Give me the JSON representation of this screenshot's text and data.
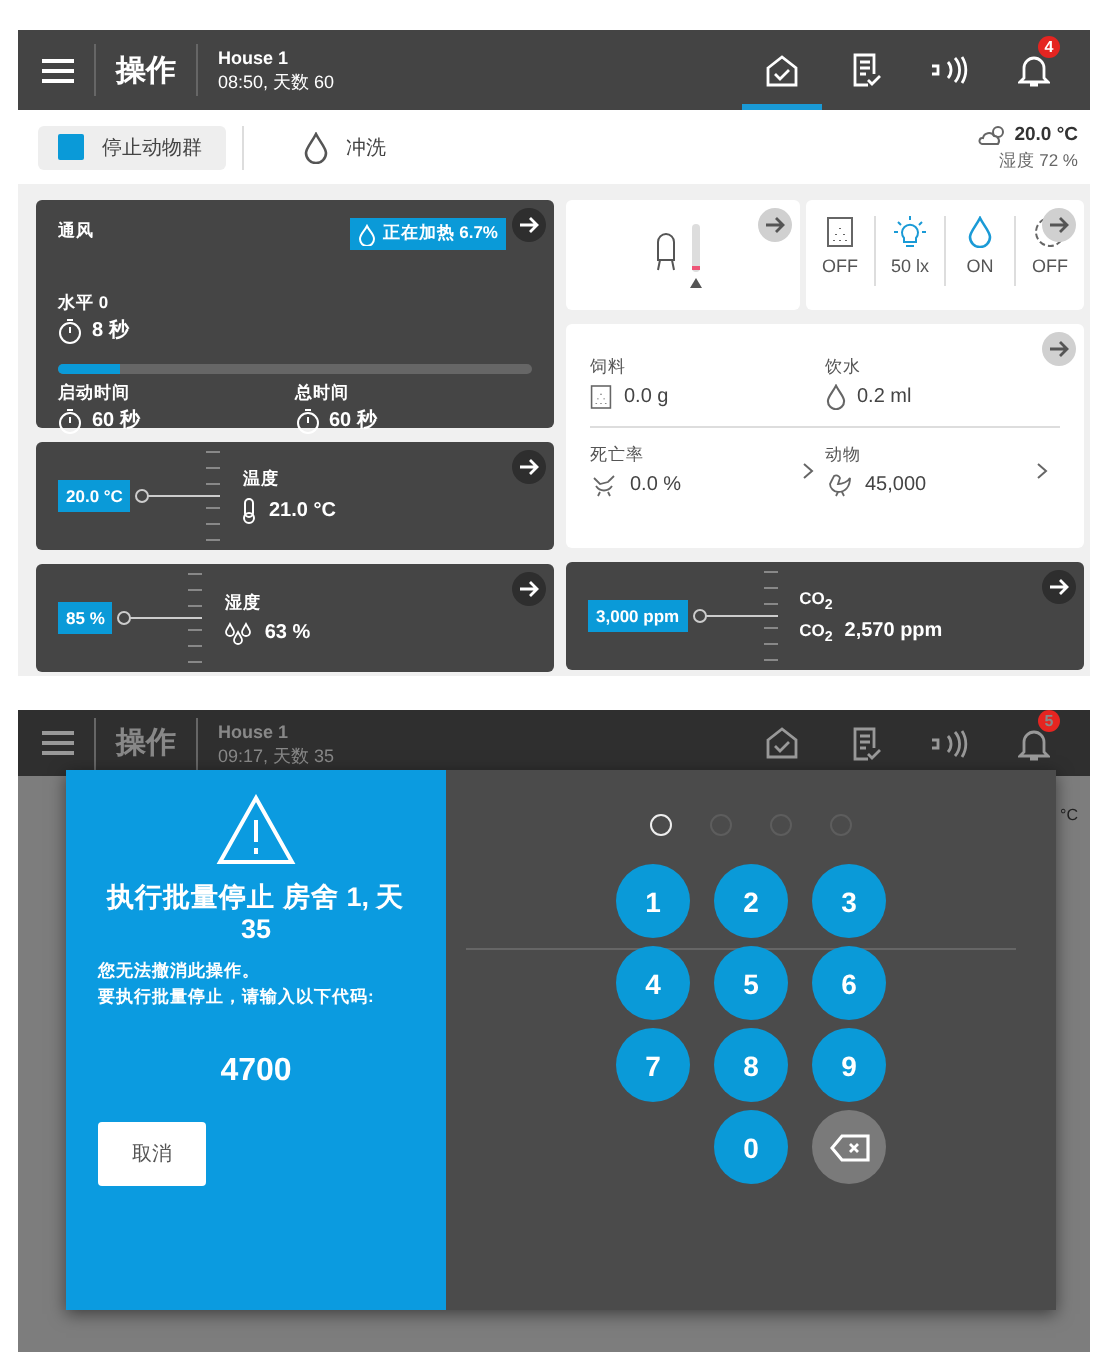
{
  "dashboard": {
    "header": {
      "title": "操作",
      "house": "House 1",
      "time": "08:50, 天数 60",
      "notification_count": "4",
      "nav": [
        {
          "kind": "home",
          "selected": true
        },
        {
          "kind": "report",
          "selected": false
        },
        {
          "kind": "signal",
          "selected": false
        },
        {
          "kind": "bell",
          "selected": false
        }
      ]
    },
    "toolbar": {
      "buttons": [
        {
          "kind": "stop",
          "label": "停止动物群"
        },
        {
          "kind": "flush",
          "label": "冲洗"
        }
      ],
      "temperature": "20.0 °C",
      "humidity": "湿度 72 %"
    },
    "ventilation": {
      "title": "通风",
      "badge": "正在加热 6.7%",
      "level_label": "水平 0",
      "level_time": "8 秒",
      "progress": {
        "level": 0.13
      },
      "start_label": "启动时间",
      "start_value": "60 秒",
      "total_label": "总时间",
      "total_value": "60 秒"
    },
    "temperature": {
      "setpoint": "20.0 °C",
      "label": "温度",
      "value": "21.0 °C"
    },
    "humidity": {
      "setpoint": "85 %",
      "label": "湿度",
      "value": "63 %"
    },
    "status": {
      "items": [
        {
          "kind": "feeder",
          "text": "OFF",
          "active": false
        },
        {
          "kind": "light",
          "text": "50 lx",
          "active": true
        },
        {
          "kind": "water",
          "text": "ON",
          "active": true
        },
        {
          "kind": "clock",
          "text": "OFF",
          "active": false
        }
      ]
    },
    "production": {
      "feed_label": "饲料",
      "feed_value": "0.0 g",
      "water_label": "饮水",
      "water_value": "0.2 ml",
      "mortality_label": "死亡率",
      "mortality_value": "0.0 %",
      "animals_label": "动物",
      "animals_value": "45,000"
    },
    "co2": {
      "setpoint": "3,000 ppm",
      "label": "CO$_{2}$",
      "value_label": "CO$_{2}$",
      "value": "2,570 ppm"
    }
  },
  "lock_screen": {
    "header": {
      "title": "操作",
      "house": "House 1",
      "time": "09:17, 天数 35",
      "notification_count": "5",
      "nav": [
        {
          "kind": "home"
        },
        {
          "kind": "report"
        },
        {
          "kind": "signal"
        },
        {
          "kind": "bell"
        }
      ]
    },
    "background_unit": "°C",
    "dialog": {
      "title": "执行批量停止 房舍 1, 天 35",
      "message": [
        "您无法撤消此操作。",
        "要执行批量停止，请输入以下代码:"
      ],
      "code": "4700",
      "cancel": "取消",
      "pin_dots": [
        {
          "selected": true
        },
        {
          "selected": false
        },
        {
          "selected": false
        },
        {
          "selected": false
        }
      ],
      "keys": [
        "1",
        "2",
        "3",
        "4",
        "5",
        "6",
        "7",
        "8",
        "9",
        "0"
      ]
    }
  }
}
